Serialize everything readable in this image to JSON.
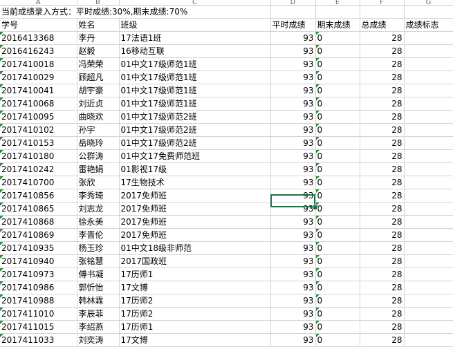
{
  "columns": [
    "A",
    "B",
    "C",
    "D",
    "E",
    "F",
    "G"
  ],
  "note": "当前成绩录入方式：平时成绩:30%,期末成绩:70%",
  "headers": [
    "学号",
    "姓名",
    "班级",
    "平时成绩",
    "期末成绩",
    "总成绩",
    "成绩标志"
  ],
  "rows": [
    {
      "id": "2016413368",
      "name": "李丹",
      "class": "17法语1班",
      "usual": "93",
      "final": "0",
      "total": "28"
    },
    {
      "id": "2016416243",
      "name": "赵毅",
      "class": "16移动互联",
      "usual": "93",
      "final": "0",
      "total": "28"
    },
    {
      "id": "2017410018",
      "name": "冯荣荣",
      "class": "01中文17级师范1班",
      "usual": "93",
      "final": "0",
      "total": "28"
    },
    {
      "id": "2017410029",
      "name": "顾超凡",
      "class": "01中文17级师范1班",
      "usual": "93",
      "final": "0",
      "total": "28"
    },
    {
      "id": "2017410041",
      "name": "胡宇豪",
      "class": "01中文17级师范1班",
      "usual": "93",
      "final": "0",
      "total": "28"
    },
    {
      "id": "2017410068",
      "name": "刘近贞",
      "class": "01中文17级师范1班",
      "usual": "93",
      "final": "0",
      "total": "28"
    },
    {
      "id": "2017410095",
      "name": "曲晓欢",
      "class": "01中文17级师范2班",
      "usual": "93",
      "final": "0",
      "total": "28"
    },
    {
      "id": "2017410102",
      "name": "孙宇",
      "class": "01中文17级师范2班",
      "usual": "93",
      "final": "0",
      "total": "28"
    },
    {
      "id": "2017410153",
      "name": "岳晓玲",
      "class": "01中文17级师范2班",
      "usual": "93",
      "final": "0",
      "total": "28"
    },
    {
      "id": "2017410180",
      "name": "公群涛",
      "class": "01中文17免费师范班",
      "usual": "93",
      "final": "0",
      "total": "28"
    },
    {
      "id": "2017410242",
      "name": "雷艳娟",
      "class": "01影视17级",
      "usual": "93",
      "final": "0",
      "total": "28"
    },
    {
      "id": "2017410700",
      "name": "张欣",
      "class": "17生物技术",
      "usual": "93",
      "final": "0",
      "total": "28"
    },
    {
      "id": "2017410856",
      "name": "李秀琦",
      "class": "2017免师班",
      "usual": "93",
      "final": "0",
      "total": "28"
    },
    {
      "id": "2017410865",
      "name": "刘志龙",
      "class": "2017免师班",
      "usual": "93",
      "final": "0",
      "total": "28"
    },
    {
      "id": "2017410868",
      "name": "徐永美",
      "class": "2017免师班",
      "usual": "93",
      "final": "0",
      "total": "28"
    },
    {
      "id": "2017410869",
      "name": "李晋伦",
      "class": "2017免师班",
      "usual": "93",
      "final": "0",
      "total": "28"
    },
    {
      "id": "2017410935",
      "name": "杨玉珍",
      "class": "01中文18级非师范",
      "usual": "93",
      "final": "0",
      "total": "28"
    },
    {
      "id": "2017410940",
      "name": "张铭慧",
      "class": "2017国政班",
      "usual": "93",
      "final": "0",
      "total": "28"
    },
    {
      "id": "2017410973",
      "name": "傅书凝",
      "class": "17历师1",
      "usual": "93",
      "final": "0",
      "total": "28"
    },
    {
      "id": "2017410986",
      "name": "郭忻怡",
      "class": "17文博",
      "usual": "93",
      "final": "0",
      "total": "28"
    },
    {
      "id": "2017410988",
      "name": "韩林霖",
      "class": "17历师2",
      "usual": "93",
      "final": "0",
      "total": "28"
    },
    {
      "id": "2017411010",
      "name": "李辰菲",
      "class": "17历师2",
      "usual": "93",
      "final": "0",
      "total": "28"
    },
    {
      "id": "2017411015",
      "name": "李绍燕",
      "class": "17历师1",
      "usual": "93",
      "final": "0",
      "total": "28"
    },
    {
      "id": "2017411033",
      "name": "刘奕涛",
      "class": "17文博",
      "usual": "93",
      "final": "0",
      "total": "28"
    }
  ],
  "accent_color": "#1e7145",
  "error_marker_color": "#2d8a3e"
}
